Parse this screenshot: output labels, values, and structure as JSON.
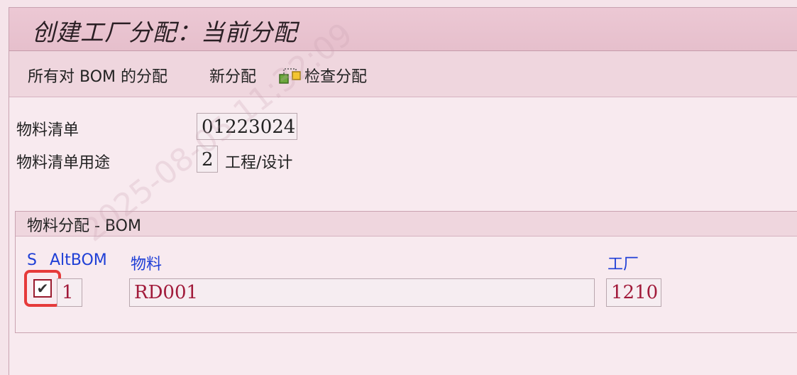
{
  "header": {
    "title": "创建工厂分配：当前分配"
  },
  "toolbar": {
    "all_bom_assignments": "所有对 BOM 的分配",
    "new_assignment": "新分配",
    "check_assignment": "检查分配"
  },
  "form": {
    "bom_label": "物料清单",
    "bom_value": "01223024",
    "usage_label": "物料清单用途",
    "usage_value": "2",
    "usage_text": "工程/设计"
  },
  "group": {
    "title": "物料分配   - BOM",
    "columns": {
      "s": "S",
      "altbom": "AltBOM",
      "material": "物料",
      "plant": "工厂"
    },
    "row": {
      "checked": true,
      "altbom": "1",
      "material": "RD001",
      "plant": "1210"
    }
  },
  "watermark": "2025-08-05  11:32:09"
}
